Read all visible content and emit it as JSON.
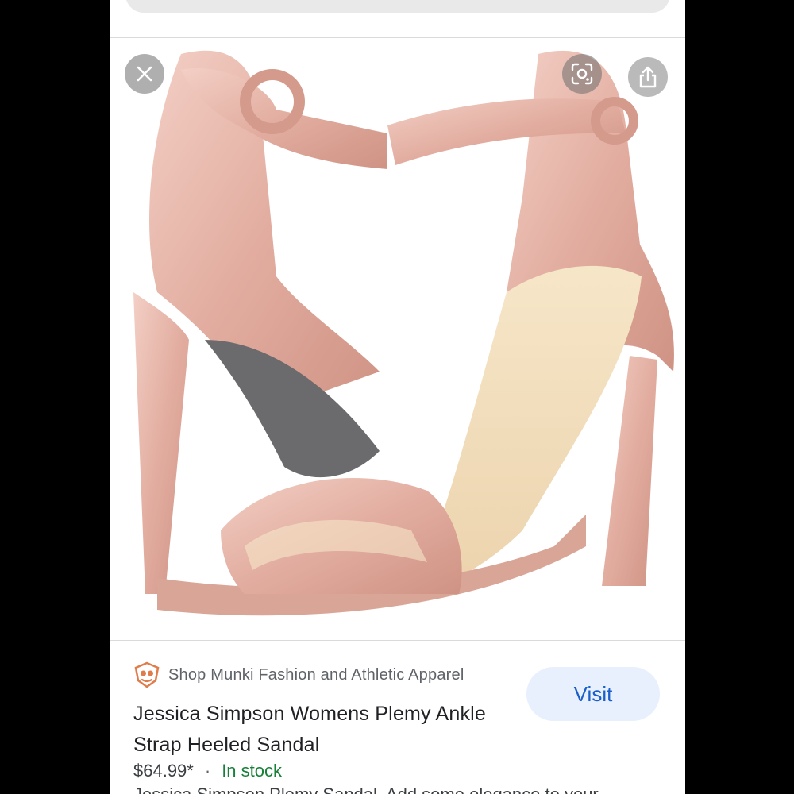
{
  "result": {
    "source_name": "Shop Munki Fashion and Athletic Apparel",
    "visit_label": "Visit",
    "title": "Jessica Simpson Womens Plemy Ankle Strap Heeled Sandal",
    "price": "$64.99*",
    "price_separator": "·",
    "stock_status": "In stock",
    "description": "Jessica Simpson Plemy Sandal. Add some elegance to your"
  },
  "icons": {
    "close": "close-icon",
    "lens": "lens-icon",
    "share": "share-icon",
    "source_logo": "munki-logo-icon"
  },
  "colors": {
    "accent": "#1a5fc9",
    "visit_bg": "#e8f0fe",
    "in_stock": "#188038",
    "shoe": "#e4b3a7"
  }
}
